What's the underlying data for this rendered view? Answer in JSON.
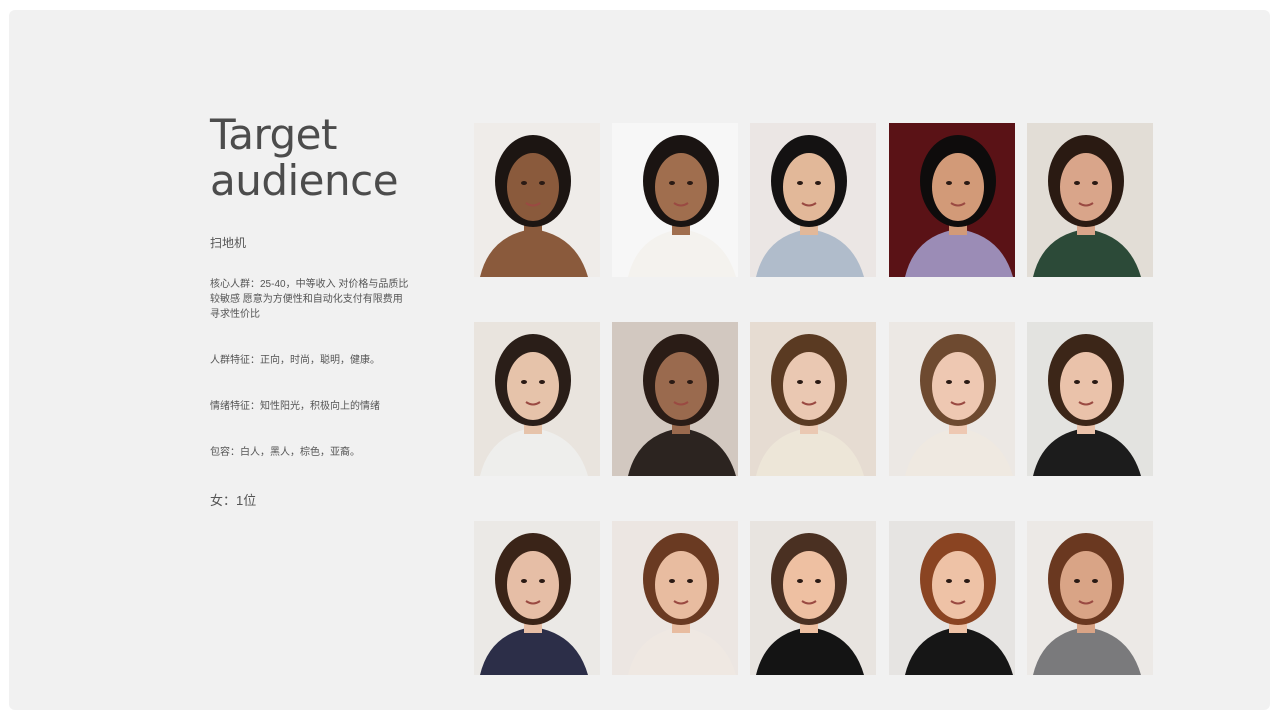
{
  "title": {
    "line1": "Target",
    "line2": "audience"
  },
  "product": "扫地机",
  "paragraphs": [
    "核心人群：25-40，中等收入 对价格与品质比较敏感 愿意为方便性和自动化支付有限费用 寻求性价比",
    "人群特征：正向，时尚，聪明，健康。",
    "情绪特征：知性阳光，积极向上的情绪",
    "包容：白人，黑人，棕色，亚裔。"
  ],
  "count": "女：1位",
  "colors": {
    "background": "#f1f1f1",
    "title": "#4c4c4c",
    "text": "#555555"
  },
  "photos": [
    {
      "name": "portrait-1",
      "bg": "#efece9",
      "skin": "#8a5a3c",
      "hair": "#1c1512",
      "cloth": "#8a5a3c"
    },
    {
      "name": "portrait-2",
      "bg": "#f7f7f7",
      "skin": "#a06e4e",
      "hair": "#1a1412",
      "cloth": "#f4f2ee"
    },
    {
      "name": "portrait-3",
      "bg": "#ebe6e4",
      "skin": "#e2b899",
      "hair": "#141212",
      "cloth": "#b0bccb"
    },
    {
      "name": "portrait-4",
      "bg": "#5a1216",
      "skin": "#d29a78",
      "hair": "#0e0c0c",
      "cloth": "#9b8cb6"
    },
    {
      "name": "portrait-5",
      "bg": "#e2ddd6",
      "skin": "#d9a58a",
      "hair": "#2a1a12",
      "cloth": "#2c4a38"
    },
    {
      "name": "portrait-6",
      "bg": "#e9e4de",
      "skin": "#e6c3aa",
      "hair": "#2a1e18",
      "cloth": "#eeeeec"
    },
    {
      "name": "portrait-7",
      "bg": "#d2c8c0",
      "skin": "#9a6a4e",
      "hair": "#2a1c16",
      "cloth": "#2c2420"
    },
    {
      "name": "portrait-8",
      "bg": "#e6dcd2",
      "skin": "#eac8b2",
      "hair": "#5a3a22",
      "cloth": "#ede6d8"
    },
    {
      "name": "portrait-9",
      "bg": "#ece8e4",
      "skin": "#eec8b2",
      "hair": "#6e4a30",
      "cloth": "#efe9e1"
    },
    {
      "name": "portrait-10",
      "bg": "#e3e3e0",
      "skin": "#eac2aa",
      "hair": "#3c2618",
      "cloth": "#1c1c1c"
    },
    {
      "name": "portrait-11",
      "bg": "#ebe9e6",
      "skin": "#e6bea6",
      "hair": "#3a2418",
      "cloth": "#2c2e48"
    },
    {
      "name": "portrait-12",
      "bg": "#ece6e2",
      "skin": "#e8bca0",
      "hair": "#6a3a22",
      "cloth": "#efe8e2"
    },
    {
      "name": "portrait-13",
      "bg": "#e8e4e0",
      "skin": "#eec0a2",
      "hair": "#4a3022",
      "cloth": "#141414"
    },
    {
      "name": "portrait-14",
      "bg": "#e6e4e2",
      "skin": "#eec2a6",
      "hair": "#8a4422",
      "cloth": "#161616"
    },
    {
      "name": "portrait-15",
      "bg": "#ece9e6",
      "skin": "#d9a486",
      "hair": "#6a3820",
      "cloth": "#7a7a7c"
    }
  ]
}
